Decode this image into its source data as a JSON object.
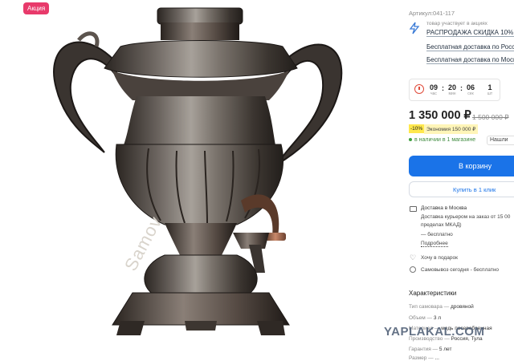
{
  "badge": {
    "label": "Акция"
  },
  "photo": {
    "watermark": "Samov"
  },
  "product": {
    "article": "Артикул:041-117",
    "promo": {
      "hint": "товар участвует в акциях",
      "links": [
        "РАСПРОДАЖА СКИДКА 10%!",
        "Бесплатная доставка по Росс",
        "Бесплатная доставка по Моск"
      ]
    },
    "timer": {
      "units": [
        {
          "value": "09",
          "label": "час"
        },
        {
          "value": "20",
          "label": "мин"
        },
        {
          "value": "06",
          "label": "сек"
        },
        {
          "value": "1",
          "label": "шт"
        }
      ]
    },
    "price": "1 350 000 ₽",
    "old_price": "1 500 000 ₽",
    "discount_badge": "-10%",
    "saving": "Экономия 150 000 ₽",
    "stock": "в наличии в 1 магазине",
    "find_label": "Нашли",
    "cart_button": "В корзину",
    "one_click_button": "Купить в 1 клик"
  },
  "delivery": {
    "title": "Доставка в Москва",
    "line1": "Доставка курьером на заказ от 15 00",
    "line2": "пределах МКАД)",
    "line3": "— бесплатно",
    "more_link": "Подробнее",
    "gift": "Хочу в подарок",
    "pickup": "Самовывоз сегодня - бесплатно"
  },
  "characteristics": {
    "title": "Характеристики",
    "rows": [
      {
        "name": "Тип самовара",
        "value": "дровяной"
      },
      {
        "name": "Объем",
        "value": "3 л"
      },
      {
        "name": "Материал",
        "value": "медь посеребренная"
      },
      {
        "name": "Производство",
        "value": "Россия, Тула"
      },
      {
        "name": "Гарантия",
        "value": "5 лет"
      },
      {
        "name": "Размер",
        "value": "..."
      }
    ]
  },
  "site_watermark": "YAPLAKAL.COM"
}
